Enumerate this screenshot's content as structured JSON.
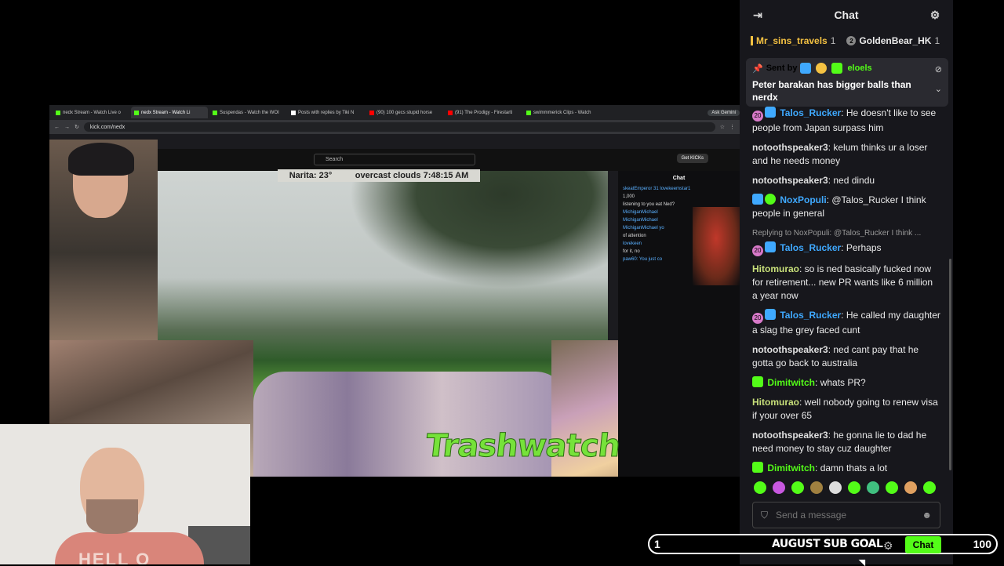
{
  "browser": {
    "tabs": [
      {
        "label": "nedx Stream - Watch Live o"
      },
      {
        "label": "nedx Stream - Watch Li"
      },
      {
        "label": "Suspendas - Watch the WOI"
      },
      {
        "label": "Posts with replies by Tiki N"
      },
      {
        "label": "(90) 100 gecs stupid horse"
      },
      {
        "label": "(91) The Prodigy - Firestarti"
      },
      {
        "label": "swimmmerick Clips - Watch"
      }
    ],
    "ask_gemini": "Ask Gemini",
    "url": "kick.com/nedx",
    "search_placeholder": "Search",
    "get_kick": "Get KICKs",
    "weather_location": "Narita: 23°",
    "weather_time": "overcast clouds 7:48:15 AM",
    "overlay_text": "Trashwatch",
    "inner_chat": {
      "title": "Chat",
      "rows": [
        "skeatEmperor 31  lovekeemstar1",
        "1,000",
        "listening to you eat Ned?",
        "MichiganMichael",
        "MichiganMichael",
        "MichiganMichael yo",
        "of attention",
        "lovekeen",
        "for it, no",
        "paw60: You just co"
      ]
    }
  },
  "webcam_shirt_text": "HELL O",
  "sub_goal": {
    "current": "1",
    "title": "AUGUST SUB GOAL",
    "target": "100"
  },
  "chat": {
    "title": "Chat",
    "leaderboard": [
      {
        "rank": "",
        "name": "Mr_sins_travels",
        "count": "1"
      },
      {
        "rank": "2",
        "name": "GoldenBear_HK",
        "count": "1"
      }
    ],
    "pinned": {
      "sent_by_label": "Sent by",
      "sender": "eloels",
      "text": "Peter barakan has bigger balls than nerdx"
    },
    "messages": [
      {
        "user": "Talos_Rucker",
        "text": "He doesn't like to see people from Japan surpass him"
      },
      {
        "user": "notoothspeaker3",
        "text": "kelum thinks ur a loser and he needs money"
      },
      {
        "user": "notoothspeaker3",
        "text": "ned dindu"
      },
      {
        "user": "NoxPopuli",
        "text": "@Talos_Rucker I think people in general"
      },
      {
        "reply_to": "Replying to NoxPopuli: @Talos_Rucker I think ...",
        "user": "Talos_Rucker",
        "text": "Perhaps"
      },
      {
        "user": "Hitomurao",
        "text": "so is ned basically fucked now for retirement... new PR wants like 6 million a year now"
      },
      {
        "user": "Talos_Rucker",
        "text": "He called my daughter a slag the grey faced cunt"
      },
      {
        "user": "notoothspeaker3",
        "text": "ned cant pay that he gotta go back to australia"
      },
      {
        "user": "Dimitwitch",
        "text": "whats PR?"
      },
      {
        "user": "Hitomurao",
        "text": "well nobody going to renew visa if your over 65"
      },
      {
        "user": "notoothspeaker3",
        "text": "he gonna lie to dad he need money to stay cuz daughter"
      },
      {
        "user": "Dimitwitch",
        "text": "damn thats a lot"
      }
    ],
    "input_placeholder": "Send a message",
    "send_label": "Chat",
    "colors": {
      "accent": "#53fc18",
      "mod": "#3fa9ff",
      "panel": "#17171c"
    }
  }
}
